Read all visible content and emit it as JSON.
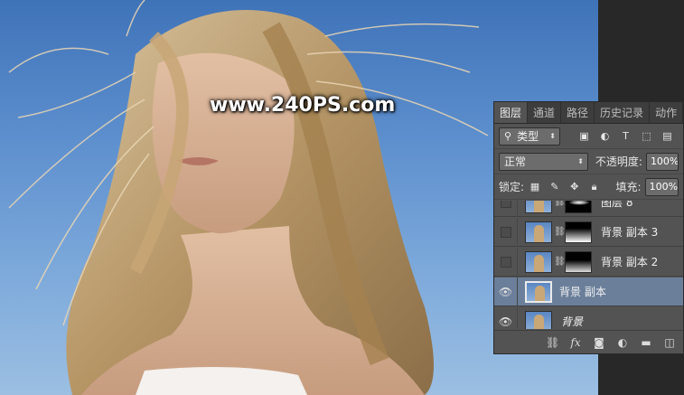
{
  "watermark": "www.240PS.com",
  "panel": {
    "tabs": [
      "图层",
      "通道",
      "路径",
      "历史记录",
      "动作"
    ],
    "filter": {
      "icon": "search-icon",
      "label": "类型"
    },
    "blend_mode": "正常",
    "opacity_label": "不透明度:",
    "opacity_value": "100%",
    "lock_label": "锁定:",
    "fill_label": "填充:",
    "fill_value": "100%",
    "layers": [
      {
        "name": "图层 8",
        "visible": false,
        "has_mask": true,
        "selected": false
      },
      {
        "name": "背景 副本 3",
        "visible": false,
        "has_mask": true,
        "selected": false
      },
      {
        "name": "背景 副本 2",
        "visible": false,
        "has_mask": true,
        "selected": false
      },
      {
        "name": "背景 副本",
        "visible": true,
        "has_mask": false,
        "selected": true
      },
      {
        "name": "背景",
        "visible": true,
        "has_mask": false,
        "selected": false
      }
    ]
  },
  "colors": {
    "panel_bg": "#535353",
    "selected_row": "#6b7f9b",
    "sky": "#5d8fce"
  }
}
